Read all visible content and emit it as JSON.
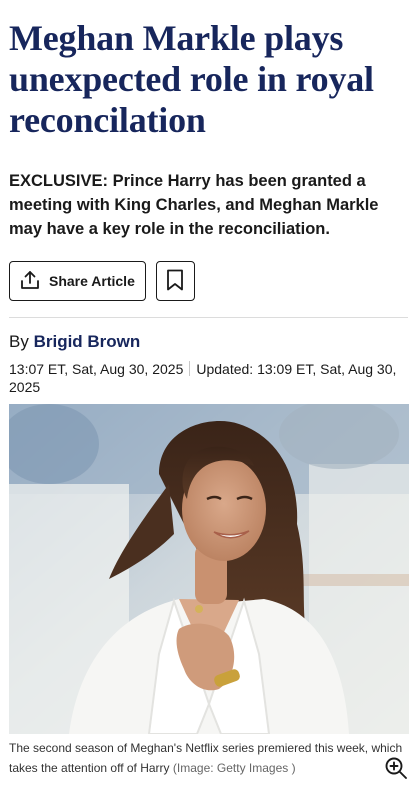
{
  "article": {
    "headline": "Meghan Markle plays unexpected role in royal reconcilation",
    "standfirst": "EXCLUSIVE: Prince Harry has been granted a meeting with King Charles, and Meghan Markle may have a key role in the reconciliation.",
    "actions": {
      "share_label": "Share Article",
      "share_icon": "upload-share-icon",
      "bookmark_icon": "bookmark-icon"
    },
    "byline": {
      "prefix": "By",
      "author": "Brigid Brown"
    },
    "published": "13:07 ET, Sat, Aug 30, 2025",
    "updated": "Updated: 13:09 ET, Sat, Aug 30, 2025",
    "image": {
      "caption": "The second season of Meghan's Netflix series premiered this week, which takes the attention off of Harry",
      "credit": "(Image: Getty Images )",
      "zoom_icon": "zoom-in-icon"
    }
  },
  "colors": {
    "headline": "#17265c",
    "author": "#17265c",
    "text": "#1a1a1a",
    "divider": "#dcdcdc"
  }
}
